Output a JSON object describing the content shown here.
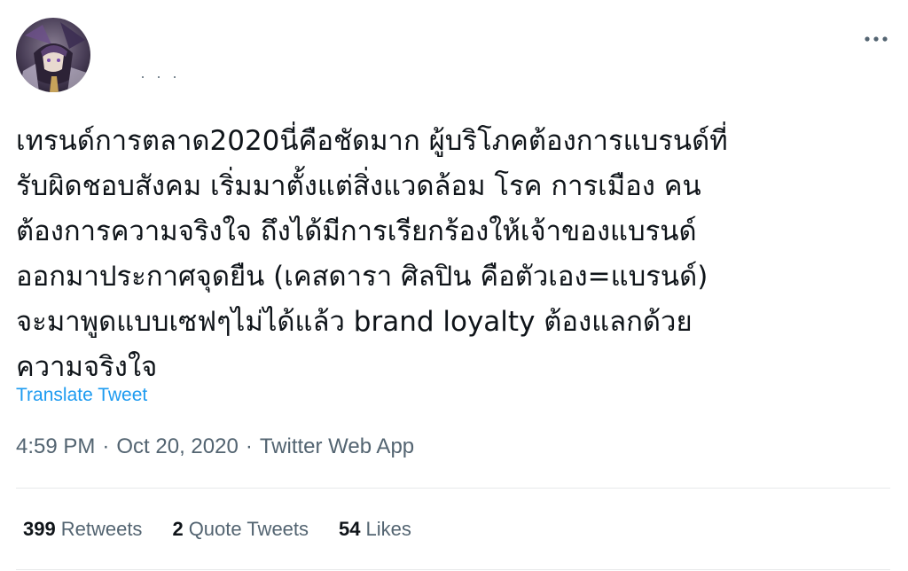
{
  "tweet": {
    "text_lines": [
      "เทรนด์การตลาด2020นี่คือชัดมาก ผู้บริโภคต้องการแบรนด์ที่",
      "รับผิดชอบสังคม เริ่มมาตั้งแต่สิ่งแวดล้อม โรค การเมือง คน",
      "ต้องการความจริงใจ ถึงได้มีการเรียกร้องให้เจ้าของแบรนด์",
      "ออกมาประกาศจุดยืน (เคสดารา ศิลปิน คือตัวเอง=แบรนด์)",
      "จะมาพูดแบบเซฟๆไม่ได้แล้ว brand loyalty ต้องแลกด้วย",
      "ความจริงใจ"
    ],
    "translate_label": "Translate Tweet",
    "time": "4:59 PM",
    "date": "Oct 20, 2020",
    "separator": "·",
    "source": "Twitter Web App",
    "more_icon": "more-horizontal-icon",
    "avatar_icon": "user-avatar-image"
  },
  "stats": {
    "retweets": {
      "count": "399",
      "label": "Retweets"
    },
    "quote_tweets": {
      "count": "2",
      "label": "Quote Tweets"
    },
    "likes": {
      "count": "54",
      "label": "Likes"
    }
  },
  "colors": {
    "text": "#0f1419",
    "secondary": "#536471",
    "link": "#1d9bf0",
    "divider": "#e7e9ea"
  }
}
